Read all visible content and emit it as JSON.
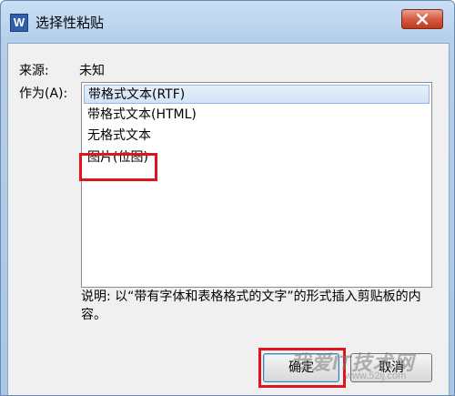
{
  "window": {
    "title": "选择性粘贴",
    "icon_letter": "W"
  },
  "form": {
    "source_label": "来源:",
    "source_value": "未知",
    "as_label": "作为(A):"
  },
  "formats": [
    {
      "label": "带格式文本(RTF)",
      "selected": true
    },
    {
      "label": "带格式文本(HTML)",
      "selected": false
    },
    {
      "label": "无格式文本",
      "selected": false
    },
    {
      "label": "图片(位图)",
      "selected": false
    }
  ],
  "description": "说明: 以“带有字体和表格格式的文字”的形式插入剪贴板的内容。",
  "buttons": {
    "ok": "确定",
    "cancel": "取消"
  },
  "watermark": {
    "text": "我爱IT技术网",
    "url": "www.52ij.com"
  },
  "colors": {
    "highlight_box": "#e0141c",
    "title_gradient_top": "#c9dff4",
    "close_button": "#c0391f"
  }
}
